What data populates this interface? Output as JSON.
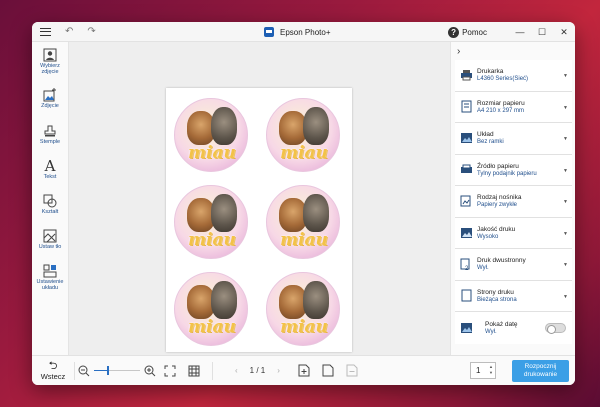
{
  "titlebar": {
    "title": "Epson Photo+",
    "help_label": "Pomoc",
    "help_glyph": "?",
    "minimize": "—",
    "maximize": "☐",
    "close": "✕",
    "undo": "↶",
    "redo": "↷"
  },
  "sidebar": {
    "items": [
      {
        "label": "Wybierz zdjęcie"
      },
      {
        "label": "Zdjęcie"
      },
      {
        "label": "Stemple"
      },
      {
        "label": "Tekst",
        "glyph": "A"
      },
      {
        "label": "Kształt"
      },
      {
        "label": "Ustaw tło"
      },
      {
        "label": "Ustawienie układu"
      }
    ]
  },
  "canvas": {
    "sticker_text": "miau",
    "sticker_count": 6
  },
  "panel": {
    "collapse": "›",
    "settings": [
      {
        "label": "Drukarka",
        "value": "L4360 Series(Sieć)",
        "icon": "printer-icon"
      },
      {
        "label": "Rozmiar papieru",
        "value": "A4 210 x 297 mm",
        "icon": "paper-size-icon"
      },
      {
        "label": "Układ",
        "value": "Bez ramki",
        "icon": "layout-icon"
      },
      {
        "label": "Źródło papieru",
        "value": "Tylny podajnik papieru",
        "icon": "paper-source-icon"
      },
      {
        "label": "Rodzaj nośnika",
        "value": "Papiery zwykłe",
        "icon": "media-type-icon"
      },
      {
        "label": "Jakość druku",
        "value": "Wysoko",
        "icon": "print-quality-icon"
      },
      {
        "label": "Druk dwustronny",
        "value": "Wył.",
        "icon": "duplex-icon"
      },
      {
        "label": "Strony druku",
        "value": "Bieżąca strona",
        "icon": "print-pages-icon"
      }
    ],
    "date": {
      "label": "Pokaż datę",
      "value": "Wył.",
      "toggle_on": false
    }
  },
  "bottombar": {
    "back_label": "Wstecz",
    "back_glyph": "⮌",
    "zoom_out": "−",
    "zoom_in": "+",
    "zoom_level": 0.3,
    "page_prev": "‹",
    "page_next": "›",
    "page_info": "1 / 1",
    "copies": "1",
    "print_line1": "Rozpocznij",
    "print_line2": "drukowanie",
    "accent": "#3b9fe6"
  }
}
